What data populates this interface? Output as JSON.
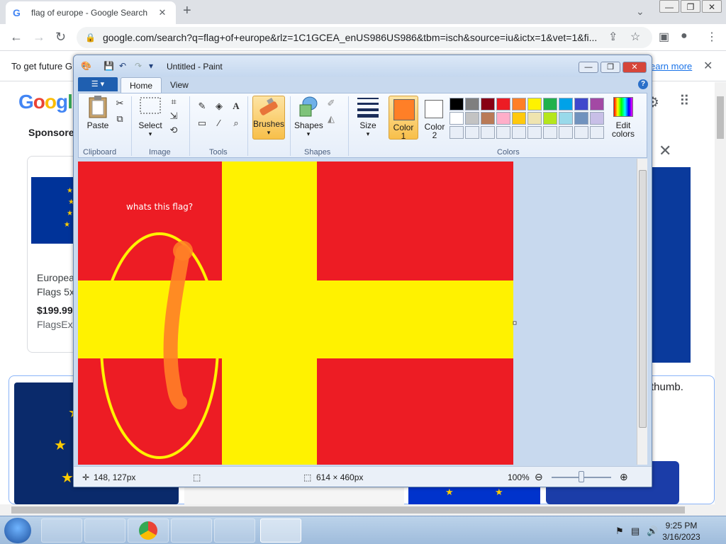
{
  "browser": {
    "tab_title": "flag of europe - Google Search",
    "url": "google.com/search?q=flag+of+europe&rlz=1C1GCEA_enUS986US986&tbm=isch&source=iu&ictx=1&vet=1&fi...",
    "infobar_text": "To get future G",
    "infobar_link": "earn more"
  },
  "google": {
    "logo": "Google",
    "sponsored": "Sponsore",
    "card_text_1": "Europea",
    "card_text_2": "Flags 5x",
    "card_price": "$199.99",
    "card_seller": "FlagsEx",
    "thumb_text": "thumb."
  },
  "paint": {
    "title": "Untitled - Paint",
    "tabs": {
      "home": "Home",
      "view": "View"
    },
    "ribbon": {
      "paste": "Paste",
      "select": "Select",
      "brushes": "Brushes",
      "shapes": "Shapes",
      "size": "Size",
      "color1_a": "Color",
      "color1_b": "1",
      "color2_a": "Color",
      "color2_b": "2",
      "edit_a": "Edit",
      "edit_b": "colors",
      "groups": {
        "clipboard": "Clipboard",
        "image": "Image",
        "tools": "Tools",
        "shapes": "Shapes",
        "colors": "Colors"
      }
    },
    "palette_row1": [
      "#000000",
      "#7f7f7f",
      "#880015",
      "#ed1c24",
      "#ff7f27",
      "#fff200",
      "#22b14c",
      "#00a2e8",
      "#3f48cc",
      "#a349a4"
    ],
    "palette_row2": [
      "#ffffff",
      "#c3c3c3",
      "#b97a57",
      "#ffaec9",
      "#ffc90e",
      "#efe4b0",
      "#b5e61d",
      "#99d9ea",
      "#7092be",
      "#c8bfe7"
    ],
    "color1": "#ff7f27",
    "color2": "#ffffff",
    "canvas_text": "whats this flag?",
    "flag_colors": {
      "red": "#ed1c24",
      "yellow": "#fff200",
      "brush": "#ff7f27"
    },
    "status": {
      "cursor": "148, 127px",
      "size": "614 × 460px",
      "zoom": "100%"
    }
  },
  "taskbar": {
    "time": "9:25 PM",
    "date": "3/16/2023"
  }
}
